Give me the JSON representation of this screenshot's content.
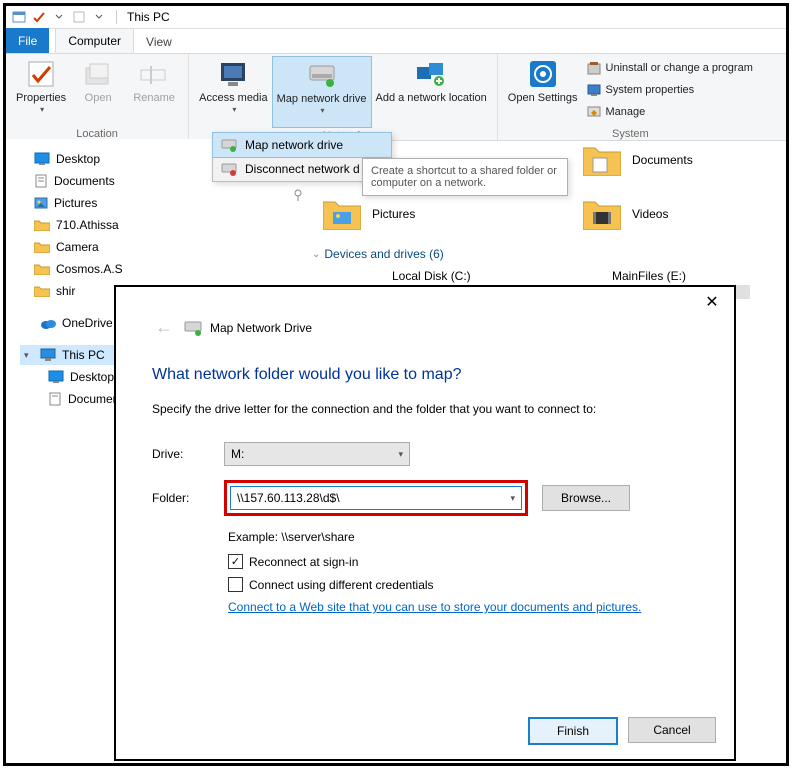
{
  "window": {
    "title": "This PC"
  },
  "tabs": {
    "file": "File",
    "computer": "Computer",
    "view": "View"
  },
  "ribbon": {
    "location": {
      "label": "Location",
      "properties": "Properties",
      "open": "Open",
      "rename": "Rename"
    },
    "network": {
      "label": "Network",
      "access_media": "Access media",
      "map_net": "Map network drive",
      "add_net": "Add a network location"
    },
    "settings_btn": "Open Settings",
    "system": {
      "label": "System",
      "uninstall": "Uninstall or change a program",
      "sysprops": "System properties",
      "manage": "Manage"
    }
  },
  "dropdown": {
    "map": "Map network drive",
    "disconnect": "Disconnect network d"
  },
  "tooltip": "Create a shortcut to a shared folder or computer on a network.",
  "nav": {
    "desktop": "Desktop",
    "documents": "Documents",
    "pictures": "Pictures",
    "f1": "710.Athissa",
    "f2": "Camera",
    "f3": "Cosmos.A.S",
    "f4": "shir",
    "onedrive": "OneDrive",
    "thispc": "This PC",
    "pc_desktop": "Desktop",
    "pc_documents": "Documents"
  },
  "content": {
    "documents": "Documents",
    "pictures": "Pictures",
    "videos": "Videos",
    "section": "Devices and drives (6)",
    "drive_c": "Local Disk (C:)",
    "drive_e": "MainFiles (E:)"
  },
  "dialog": {
    "title": "Map Network Drive",
    "heading": "What network folder would you like to map?",
    "instruction": "Specify the drive letter for the connection and the folder that you want to connect to:",
    "drive_label": "Drive:",
    "drive_value": "M:",
    "folder_label": "Folder:",
    "folder_value": "\\\\157.60.113.28\\d$\\",
    "browse": "Browse...",
    "example": "Example: \\\\server\\share",
    "reconnect": "Reconnect at sign-in",
    "creds": "Connect using different credentials",
    "link": "Connect to a Web site that you can use to store your documents and pictures",
    "finish": "Finish",
    "cancel": "Cancel"
  }
}
